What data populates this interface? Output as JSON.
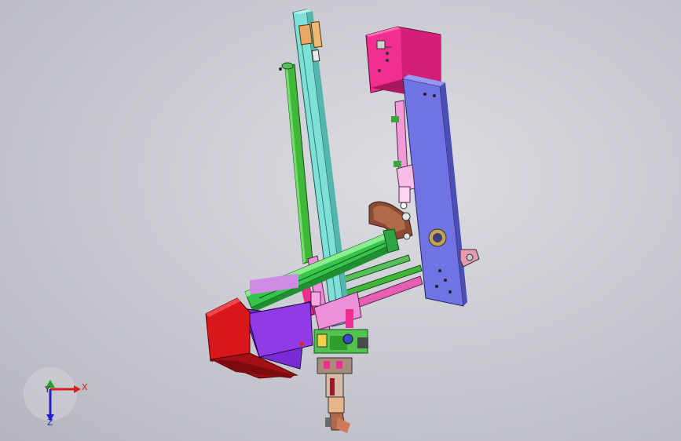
{
  "viewport": {
    "title": "",
    "triad": {
      "x_label": "X",
      "y_label": "Y",
      "z_label": "Z"
    }
  },
  "colors": {
    "background": "#c9cad1",
    "cyan_rail": "#7fe0d8",
    "green_rod": "#3fb83a",
    "magenta_box": "#ee2f8f",
    "blue_plate": "#6f72e0",
    "red_motor": "#d8161c",
    "purple_motor": "#7a2ad6",
    "brown_link": "#8a4a33",
    "pink_frame": "#e98ad8"
  }
}
